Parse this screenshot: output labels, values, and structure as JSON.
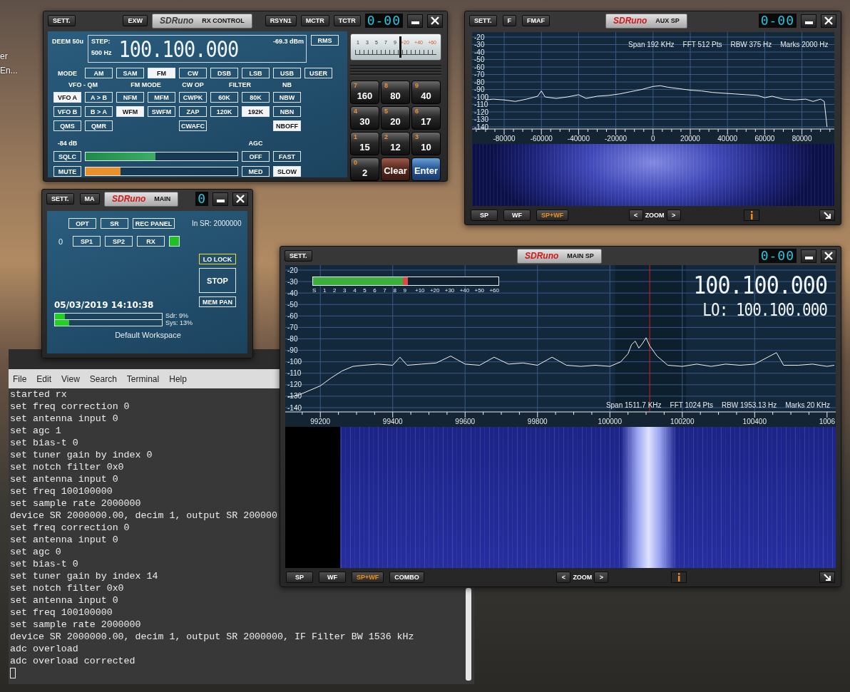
{
  "desktop": {
    "icon_labels": [
      "er",
      "En..."
    ]
  },
  "rx_control": {
    "focused": true,
    "left_buttons": [
      "SETT.",
      "EXW"
    ],
    "logo": "SDRuno",
    "title": "RX CONTROL",
    "right_buttons": [
      "RSYN1",
      "MCTR",
      "TCTR"
    ],
    "digit_display": "0-00",
    "deem": "DEEM 50u",
    "step_label": "STEP:",
    "step_value": "500 Hz",
    "frequency": "100.100.000",
    "signal": "-69.3 dBm",
    "rms_button": "RMS",
    "mode_label": "MODE",
    "modes": [
      {
        "label": "AM",
        "selected": false
      },
      {
        "label": "SAM",
        "selected": false
      },
      {
        "label": "FM",
        "selected": true
      },
      {
        "label": "CW",
        "selected": false
      },
      {
        "label": "DSB",
        "selected": false
      },
      {
        "label": "LSB",
        "selected": false
      },
      {
        "label": "USB",
        "selected": false
      },
      {
        "label": "USER",
        "selected": false
      }
    ],
    "groups": [
      {
        "label": "VFO - QM",
        "rows": [
          [
            {
              "label": "VFO A",
              "selected": true
            },
            {
              "label": "A > B",
              "selected": false
            }
          ],
          [
            {
              "label": "VFO B",
              "selected": false
            },
            {
              "label": "B > A",
              "selected": false
            }
          ],
          [
            {
              "label": "QMS",
              "selected": false
            },
            {
              "label": "QMR",
              "selected": false
            }
          ]
        ]
      },
      {
        "label": "FM MODE",
        "rows": [
          [
            {
              "label": "NFM",
              "selected": false
            },
            {
              "label": "MFM",
              "selected": false
            }
          ],
          [
            {
              "label": "WFM",
              "selected": true
            },
            {
              "label": "SWFM",
              "selected": false
            }
          ]
        ]
      },
      {
        "label": "CW OP",
        "rows": [
          [
            {
              "label": "CWPK",
              "selected": false
            }
          ],
          [
            {
              "label": "ZAP",
              "selected": false
            }
          ],
          [
            {
              "label": "CWAFC",
              "selected": false
            }
          ]
        ]
      },
      {
        "label": "FILTER",
        "rows": [
          [
            {
              "label": "60K",
              "selected": false
            },
            {
              "label": "80K",
              "selected": false
            }
          ],
          [
            {
              "label": "120K",
              "selected": false
            },
            {
              "label": "192K",
              "selected": true
            }
          ]
        ]
      },
      {
        "label": "NB",
        "rows": [
          [
            {
              "label": "NBW",
              "selected": false
            }
          ],
          [
            {
              "label": "NBN",
              "selected": false
            }
          ],
          [
            {
              "label": "NBOFF",
              "selected": true
            }
          ]
        ]
      }
    ],
    "squelch": {
      "reading": "-84 dB",
      "button": "SQLC",
      "level": 0.46
    },
    "mute": {
      "button": "MUTE",
      "level": 0.23
    },
    "agc": {
      "label": "AGC",
      "buttons": [
        {
          "label": "OFF",
          "selected": false
        },
        {
          "label": "FAST",
          "selected": false
        },
        {
          "label": "MED",
          "selected": false
        },
        {
          "label": "SLOW",
          "selected": true
        }
      ]
    },
    "s_meter": {
      "scale": [
        "1",
        "3",
        "5",
        "7",
        "9",
        "+20",
        "+40",
        "+60"
      ],
      "level": 0.56
    },
    "keypad": [
      {
        "kind": "band",
        "digit": "7",
        "label": "160"
      },
      {
        "kind": "band",
        "digit": "8",
        "label": "80"
      },
      {
        "kind": "band",
        "digit": "9",
        "label": "40"
      },
      {
        "kind": "band",
        "digit": "4",
        "label": "30"
      },
      {
        "kind": "band",
        "digit": "5",
        "label": "20"
      },
      {
        "kind": "band",
        "digit": "6",
        "label": "17"
      },
      {
        "kind": "band",
        "digit": "1",
        "label": "15"
      },
      {
        "kind": "band",
        "digit": "2",
        "label": "12"
      },
      {
        "kind": "band",
        "digit": "3",
        "label": "10"
      },
      {
        "kind": "band",
        "digit": "0",
        "label": "2"
      },
      {
        "kind": "clear",
        "label": "Clear"
      },
      {
        "kind": "enter",
        "label": "Enter"
      }
    ]
  },
  "aux_spectrum": {
    "focused": false,
    "left_buttons": [
      "SETT.",
      "F",
      "FMAF"
    ],
    "logo": "SDRuno",
    "title": "AUX SP",
    "digit_display": "0-00",
    "info": [
      "Span 192 KHz",
      "FFT 512 Pts",
      "RBW 375 Hz",
      "Marks 2000 Hz"
    ],
    "chart_data": {
      "type": "line",
      "grid": true,
      "xlim": [
        -97250,
        97400
      ],
      "ylim": [
        -140,
        -20
      ],
      "x": [
        -90000,
        -86000,
        -80000,
        -74000,
        -68000,
        -62000,
        -60000,
        -58000,
        -52000,
        -46000,
        -40000,
        -36000,
        -30000,
        -24000,
        -18000,
        -12000,
        -6000,
        0,
        4000,
        8000,
        14000,
        20000,
        26000,
        32000,
        38000,
        44000,
        50000,
        56000,
        60000,
        64000,
        70000,
        76000,
        82000,
        86000,
        90000,
        92000,
        93500
      ],
      "values": [
        -104,
        -103,
        -104,
        -106,
        -103,
        -99,
        -92,
        -100,
        -102,
        -100,
        -97,
        -102,
        -99,
        -98,
        -96,
        -93,
        -90,
        -86,
        -85,
        -87,
        -89,
        -91,
        -92,
        -94,
        -95,
        -96,
        -97,
        -98,
        -101,
        -99,
        -103,
        -104,
        -103,
        -106,
        -103,
        -106,
        -140
      ],
      "xticks": [
        -80000,
        -60000,
        -40000,
        -20000,
        0,
        20000,
        40000,
        60000,
        80000
      ],
      "yticks": [
        -20,
        -30,
        -40,
        -50,
        -60,
        -70,
        -80,
        -90,
        -100,
        -110,
        -120,
        -130,
        -140
      ]
    },
    "view_buttons": [
      {
        "label": "SP",
        "selected": false
      },
      {
        "label": "WF",
        "selected": false
      },
      {
        "label": "SP+WF",
        "selected": true
      }
    ],
    "zoom": {
      "prev": "<",
      "label": "ZOOM",
      "next": ">"
    }
  },
  "main": {
    "focused": false,
    "left_buttons": [
      "SETT.",
      "MA"
    ],
    "logo": "SDRuno",
    "title": "MAIN",
    "digit_display": "0",
    "top_buttons": [
      "OPT",
      "SR",
      "REC PANEL"
    ],
    "in_sr": "In SR: 2000000",
    "device_index": "0",
    "device_buttons": [
      "SP1",
      "SP2",
      "RX"
    ],
    "lo_lock": {
      "label": "LO LOCK",
      "highlighted": true
    },
    "stop_button": "STOP",
    "mem_pan_button": "MEM PAN",
    "datetime": "05/03/2019 14:10:38",
    "load": [
      {
        "label": "Sdr: 9%",
        "level": 0.09
      },
      {
        "label": "Sys: 13%",
        "level": 0.13
      }
    ],
    "workspace": "Default Workspace"
  },
  "main_spectrum": {
    "focused": false,
    "left_buttons": [
      "SETT."
    ],
    "logo": "SDRuno",
    "title": "MAIN SP",
    "digit_display": "0-00",
    "frequency": "100.100.000",
    "lo": "LO: 100.100.000",
    "s_meter": {
      "scale": [
        "S",
        "1",
        "2",
        "3",
        "4",
        "5",
        "6",
        "7",
        "8",
        "9",
        "+10",
        "+20",
        "+30",
        "+40",
        "+50",
        "+60"
      ],
      "level": 0.51
    },
    "info": [
      "Span 1511.7 KHz",
      "FFT 1024 Pts",
      "RBW 1953.13 Hz",
      "Marks 20 KHz"
    ],
    "chart_data": {
      "type": "line",
      "grid": true,
      "xlim": [
        99103,
        100624
      ],
      "ylim": [
        -140,
        -20
      ],
      "ref_lines": [
        {
          "axis": "x",
          "value": 100110
        }
      ],
      "bands": [
        {
          "axis": "x",
          "from": 100015,
          "to": 100210
        }
      ],
      "x": [
        99110,
        99140,
        99170,
        99200,
        99230,
        99260,
        99290,
        99320,
        99360,
        99400,
        99420,
        99440,
        99480,
        99520,
        99560,
        99600,
        99640,
        99680,
        99720,
        99760,
        99800,
        99840,
        99880,
        99920,
        99960,
        100000,
        100030,
        100050,
        100060,
        100070,
        100080,
        100090,
        100100,
        100110,
        100130,
        100160,
        100200,
        100240,
        100280,
        100320,
        100360,
        100400,
        100460,
        100480,
        100520,
        100560,
        100600,
        100620
      ],
      "values": [
        -131,
        -129,
        -125,
        -121,
        -114,
        -108,
        -104,
        -103,
        -102,
        -103,
        -96,
        -103,
        -102,
        -101,
        -95,
        -102,
        -103,
        -96,
        -102,
        -101,
        -103,
        -96,
        -103,
        -104,
        -103,
        -104,
        -100,
        -93,
        -85,
        -82,
        -88,
        -84,
        -79,
        -86,
        -95,
        -103,
        -104,
        -102,
        -104,
        -102,
        -103,
        -102,
        -92,
        -103,
        -103,
        -102,
        -104,
        -103
      ],
      "xticks": [
        99200,
        99400,
        99600,
        99800,
        100000,
        100200,
        100400
      ],
      "yticks": [
        -20,
        -30,
        -40,
        -50,
        -60,
        -70,
        -80,
        -90,
        -100,
        -110,
        -120,
        -130,
        -140
      ]
    },
    "x_axis_cut_label": "1006",
    "view_buttons": [
      {
        "label": "SP",
        "selected": false
      },
      {
        "label": "WF",
        "selected": false
      },
      {
        "label": "SP+WF",
        "selected": true
      },
      {
        "label": "COMBO",
        "selected": false
      }
    ],
    "zoom": {
      "prev": "<",
      "label": "ZOOM",
      "next": ">"
    }
  },
  "terminal": {
    "menu": [
      "File",
      "Edit",
      "View",
      "Search",
      "Terminal",
      "Help"
    ],
    "lines": [
      "started rx",
      "set freq correction 0",
      "set antenna input 0",
      "set agc 1",
      "set bias-t 0",
      "set tuner gain by index 0",
      "set notch filter 0x0",
      "set antenna input 0",
      "set freq 100100000",
      "set sample rate 2000000",
      "device SR 2000000.00, decim 1, output SR 200000",
      "set freq correction 0",
      "set antenna input 0",
      "set agc 0",
      "set bias-t 0",
      "set tuner gain by index 14",
      "set notch filter 0x0",
      "set antenna input 0",
      "set freq 100100000",
      "set sample rate 2000000",
      "device SR 2000000.00, decim 1, output SR 2000000, IF Filter BW 1536 kHz",
      "adc overload",
      "adc overload corrected"
    ]
  }
}
